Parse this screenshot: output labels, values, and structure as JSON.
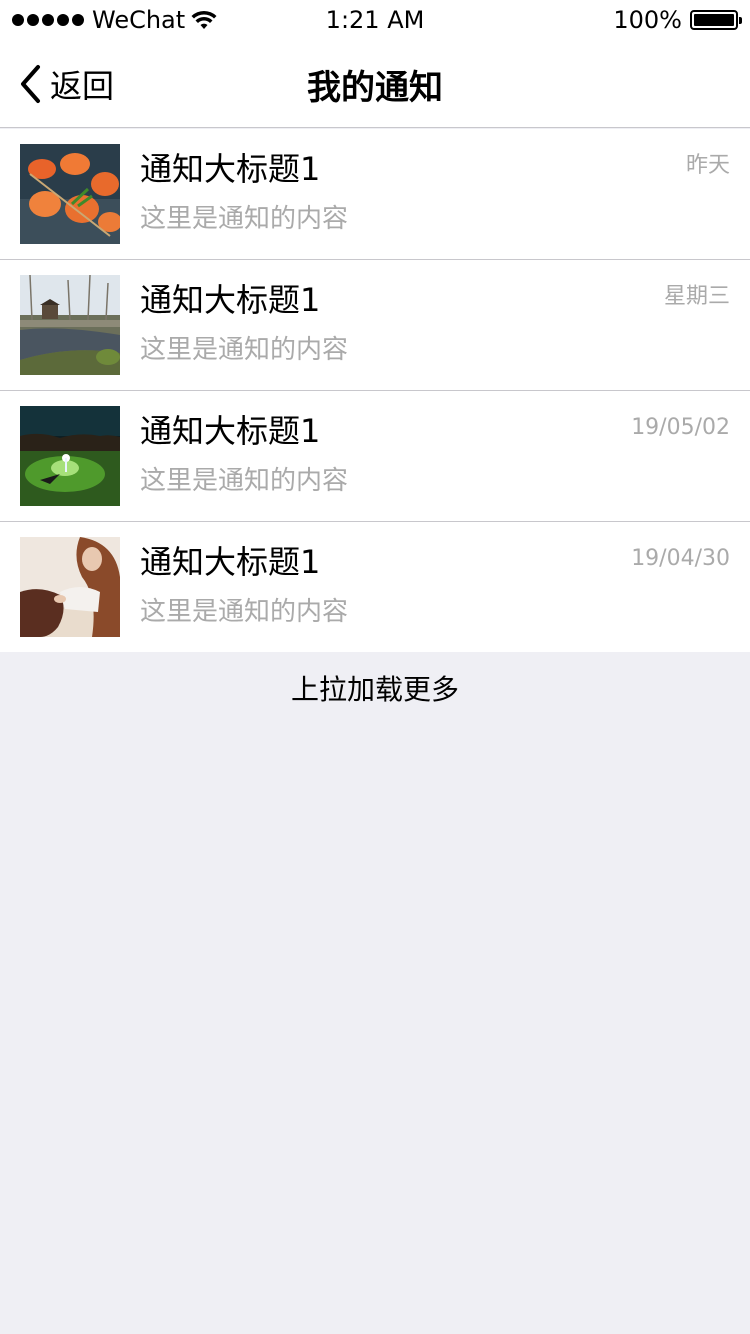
{
  "status": {
    "carrier": "WeChat",
    "time": "1:21 AM",
    "battery": "100%",
    "battery_level": 1.0
  },
  "nav": {
    "back_label": "返回",
    "title": "我的通知"
  },
  "notifications": [
    {
      "title": "通知大标题1",
      "body": "这里是通知的内容",
      "date": "昨天",
      "thumbnail": "shrimp-skewers-photo"
    },
    {
      "title": "通知大标题1",
      "body": "这里是通知的内容",
      "date": "星期三",
      "thumbnail": "river-landscape-photo"
    },
    {
      "title": "通知大标题1",
      "body": "这里是通知的内容",
      "date": "19/05/02",
      "thumbnail": "night-light-field-photo"
    },
    {
      "title": "通知大标题1",
      "body": "这里是通知的内容",
      "date": "19/04/30",
      "thumbnail": "woman-with-horse-photo"
    }
  ],
  "footer": {
    "load_more": "上拉加载更多"
  },
  "colors": {
    "background": "#efeff4",
    "separator": "#c8c7cc",
    "secondary_text": "#aaaaaa"
  }
}
